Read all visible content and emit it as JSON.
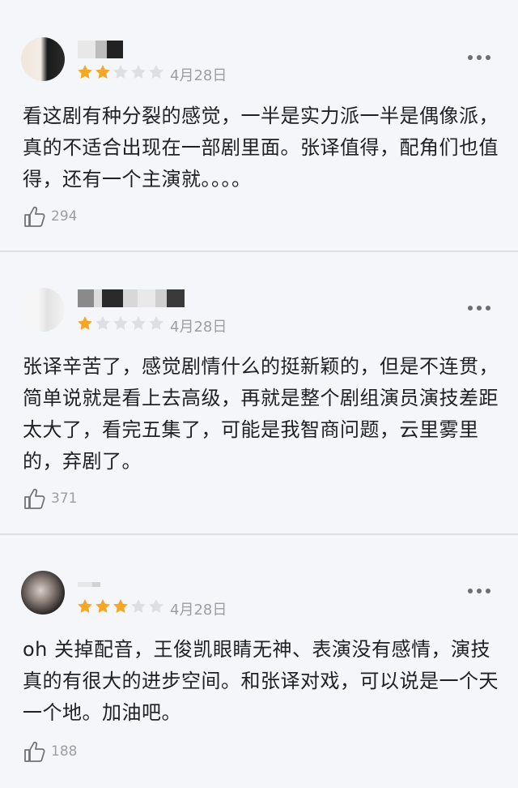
{
  "reviews": [
    {
      "rating": 2,
      "date": "4月28日",
      "text": "看这剧有种分裂的感觉，一半是实力派一半是偶像派，真的不适合出现在一部剧里面。张译值得，配角们也值得，还有一个主演就。。。。",
      "likes": "294"
    },
    {
      "rating": 1,
      "date": "4月28日",
      "text": "张译辛苦了，感觉剧情什么的挺新颖的，但是不连贯，简单说就是看上去高级，再就是整个剧组演员演技差距太大了，看完五集了，可能是我智商问题，云里雾里的，弃剧了。",
      "likes": "371"
    },
    {
      "rating": 3,
      "date": "4月28日",
      "text": "oh  关掉配音，王俊凯眼睛无神、表演没有感情，演技真的有很大的进步空间。和张译对戏，可以说是一个天一个地。加油吧。",
      "likes": "188"
    }
  ],
  "icons": {
    "star_on": "#f5a623",
    "star_off": "#dcdfe4",
    "more": "more-icon",
    "like": "thumbs-up-icon"
  }
}
